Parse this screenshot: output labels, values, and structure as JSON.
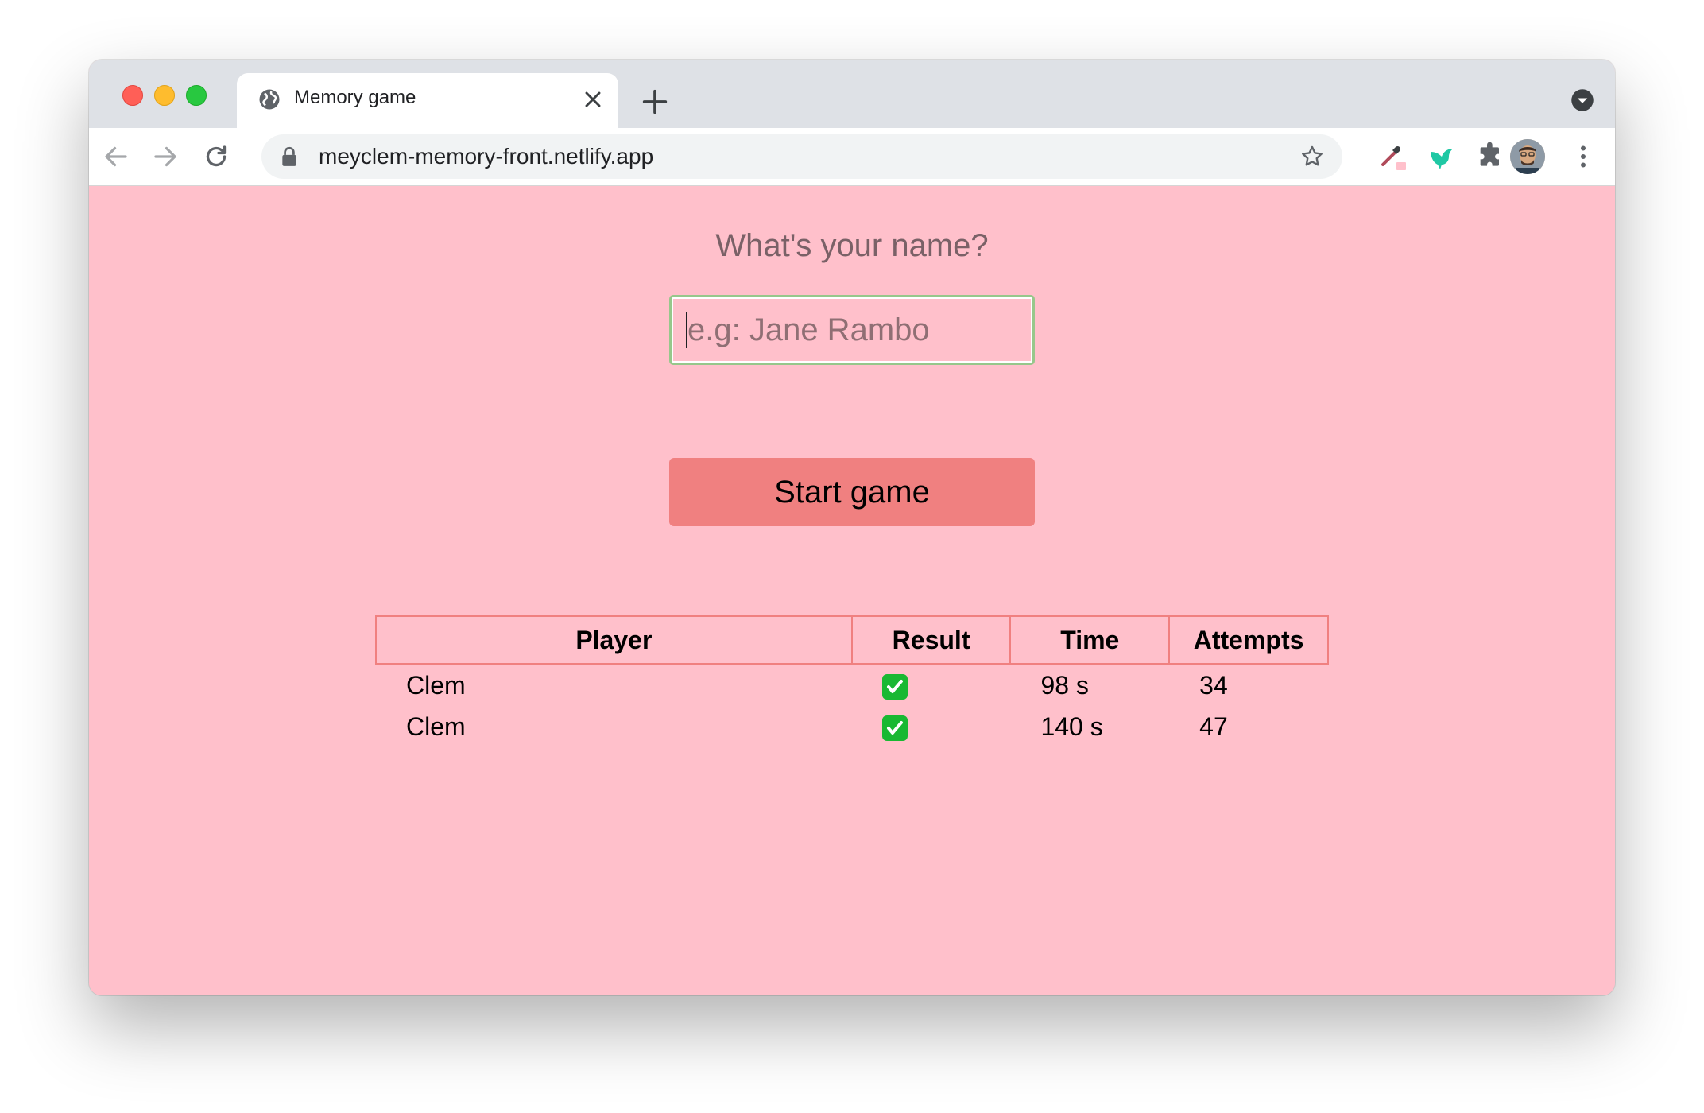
{
  "browser": {
    "tab_title": "Memory game",
    "url": "meyclem-memory-front.netlify.app"
  },
  "page": {
    "prompt": "What's your name?",
    "name_input": {
      "value": "",
      "placeholder": "e.g: Jane Rambo"
    },
    "start_button": "Start game"
  },
  "scores": {
    "headers": [
      "Player",
      "Result",
      "Time",
      "Attempts"
    ],
    "rows": [
      {
        "player": "Clem",
        "result": "success",
        "time": "98 s",
        "attempts": "34"
      },
      {
        "player": "Clem",
        "result": "success",
        "time": "140 s",
        "attempts": "47"
      }
    ]
  },
  "colors": {
    "page_background": "#ffc0cb",
    "accent": "#f08080",
    "input_border": "#97c78b",
    "check": "#19b832"
  },
  "icons": {
    "tab_favicon": "globe-icon",
    "result_success": "check-mark-icon"
  }
}
